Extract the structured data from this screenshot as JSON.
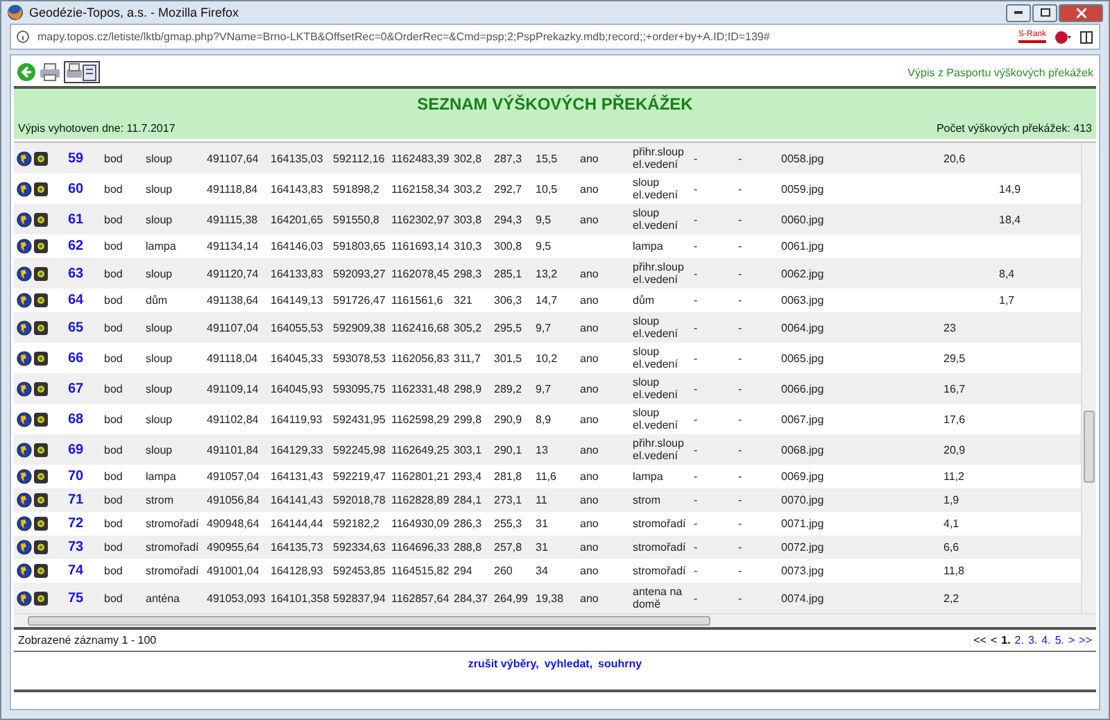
{
  "window": {
    "title": "Geodézie-Topos, a.s. - Mozilla Firefox"
  },
  "address_bar": {
    "url": "mapy.topos.cz/letiste/lktb/gmap.php?VName=Brno-LKTB&OffsetRec=0&OrderRec=&Cmd=psp;2;PspPrekazky.mdb;record;;+order+by+A.ID;ID=139#",
    "badge": "S-Rank"
  },
  "toolbar": {
    "link": "Výpis z Pasportu výškových překážek"
  },
  "header": {
    "title": "SEZNAM VÝŠKOVÝCH PŘEKÁŽEK",
    "date": "Výpis vyhotoven dne: 11.7.2017",
    "count": "Počet výškových překážek: 413"
  },
  "table": {
    "rows": [
      {
        "number": "59",
        "column_3": "bod",
        "column_4": "sloup",
        "column_5": "491107,64",
        "column_6": "164135,03",
        "column_7": "592112,16",
        "column_8": "1162483,39",
        "column_9": "302,8",
        "column_10": "287,3",
        "column_11": "15,5",
        "column_12": "ano",
        "column_13": "přihr.sloup el.vedení",
        "column_14": "-",
        "column_15": "-",
        "column_16": "0058.jpg",
        "column_17": "20,6"
      },
      {
        "number": "60",
        "column_3": "bod",
        "column_4": "sloup",
        "column_5": "491118,84",
        "column_6": "164143,83",
        "column_7": "591898,2",
        "column_8": "1162158,34",
        "column_9": "303,2",
        "column_10": "292,7",
        "column_11": "10,5",
        "column_12": "ano",
        "column_13": "sloup el.vedení",
        "column_14": "-",
        "column_15": "-",
        "column_16": "0059.jpg",
        "column_18": "14,9"
      },
      {
        "number": "61",
        "column_3": "bod",
        "column_4": "sloup",
        "column_5": "491115,38",
        "column_6": "164201,65",
        "column_7": "591550,8",
        "column_8": "1162302,97",
        "column_9": "303,8",
        "column_10": "294,3",
        "column_11": "9,5",
        "column_12": "ano",
        "column_13": "sloup el.vedení",
        "column_14": "-",
        "column_15": "-",
        "column_16": "0060.jpg",
        "column_18": "18,4"
      },
      {
        "number": "62",
        "column_3": "bod",
        "column_4": "lampa",
        "column_5": "491134,14",
        "column_6": "164146,03",
        "column_7": "591803,65",
        "column_8": "1161693,14",
        "column_9": "310,3",
        "column_10": "300,8",
        "column_11": "9,5",
        "column_13": "lampa",
        "column_14": "-",
        "column_15": "-",
        "column_16": "0061.jpg"
      },
      {
        "number": "63",
        "column_3": "bod",
        "column_4": "sloup",
        "column_5": "491120,74",
        "column_6": "164133,83",
        "column_7": "592093,27",
        "column_8": "1162078,45",
        "column_9": "298,3",
        "column_10": "285,1",
        "column_11": "13,2",
        "column_12": "ano",
        "column_13": "přihr.sloup el.vedení",
        "column_14": "-",
        "column_15": "-",
        "column_16": "0062.jpg",
        "column_18": "8,4"
      },
      {
        "number": "64",
        "column_3": "bod",
        "column_4": "dům",
        "column_5": "491138,64",
        "column_6": "164149,13",
        "column_7": "591726,47",
        "column_8": "1161561,6",
        "column_9": "321",
        "column_10": "306,3",
        "column_11": "14,7",
        "column_12": "ano",
        "column_13": "dům",
        "column_14": "-",
        "column_15": "-",
        "column_16": "0063.jpg",
        "column_18": "1,7"
      },
      {
        "number": "65",
        "column_3": "bod",
        "column_4": "sloup",
        "column_5": "491107,04",
        "column_6": "164055,53",
        "column_7": "592909,38",
        "column_8": "1162416,68",
        "column_9": "305,2",
        "column_10": "295,5",
        "column_11": "9,7",
        "column_12": "ano",
        "column_13": "sloup el.vedení",
        "column_14": "-",
        "column_15": "-",
        "column_16": "0064.jpg",
        "column_17": "23"
      },
      {
        "number": "66",
        "column_3": "bod",
        "column_4": "sloup",
        "column_5": "491118,04",
        "column_6": "164045,33",
        "column_7": "593078,53",
        "column_8": "1162056,83",
        "column_9": "311,7",
        "column_10": "301,5",
        "column_11": "10,2",
        "column_12": "ano",
        "column_13": "sloup el.vedení",
        "column_14": "-",
        "column_15": "-",
        "column_16": "0065.jpg",
        "column_17": "29,5"
      },
      {
        "number": "67",
        "column_3": "bod",
        "column_4": "sloup",
        "column_5": "491109,14",
        "column_6": "164045,93",
        "column_7": "593095,75",
        "column_8": "1162331,48",
        "column_9": "298,9",
        "column_10": "289,2",
        "column_11": "9,7",
        "column_12": "ano",
        "column_13": "sloup el.vedení",
        "column_14": "-",
        "column_15": "-",
        "column_16": "0066.jpg",
        "column_17": "16,7"
      },
      {
        "number": "68",
        "column_3": "bod",
        "column_4": "sloup",
        "column_5": "491102,84",
        "column_6": "164119,93",
        "column_7": "592431,95",
        "column_8": "1162598,29",
        "column_9": "299,8",
        "column_10": "290,9",
        "column_11": "8,9",
        "column_12": "ano",
        "column_13": "sloup el.vedení",
        "column_14": "-",
        "column_15": "-",
        "column_16": "0067.jpg",
        "column_17": "17,6"
      },
      {
        "number": "69",
        "column_3": "bod",
        "column_4": "sloup",
        "column_5": "491101,84",
        "column_6": "164129,33",
        "column_7": "592245,98",
        "column_8": "1162649,25",
        "column_9": "303,1",
        "column_10": "290,1",
        "column_11": "13",
        "column_12": "ano",
        "column_13": "přihr.sloup el.vedení",
        "column_14": "-",
        "column_15": "-",
        "column_16": "0068.jpg",
        "column_17": "20,9"
      },
      {
        "number": "70",
        "column_3": "bod",
        "column_4": "lampa",
        "column_5": "491057,04",
        "column_6": "164131,43",
        "column_7": "592219,47",
        "column_8": "1162801,21",
        "column_9": "293,4",
        "column_10": "281,8",
        "column_11": "11,6",
        "column_12": "ano",
        "column_13": "lampa",
        "column_14": "-",
        "column_15": "-",
        "column_16": "0069.jpg",
        "column_17": "11,2"
      },
      {
        "number": "71",
        "column_3": "bod",
        "column_4": "strom",
        "column_5": "491056,84",
        "column_6": "164141,43",
        "column_7": "592018,78",
        "column_8": "1162828,89",
        "column_9": "284,1",
        "column_10": "273,1",
        "column_11": "11",
        "column_12": "ano",
        "column_13": "strom",
        "column_14": "-",
        "column_15": "-",
        "column_16": "0070.jpg",
        "column_17": "1,9"
      },
      {
        "number": "72",
        "column_3": "bod",
        "column_4": "stromořadí",
        "column_5": "490948,64",
        "column_6": "164144,44",
        "column_7": "592182,2",
        "column_8": "1164930,09",
        "column_9": "286,3",
        "column_10": "255,3",
        "column_11": "31",
        "column_12": "ano",
        "column_13": "stromořadí",
        "column_14": "-",
        "column_15": "-",
        "column_16": "0071.jpg",
        "column_17": "4,1"
      },
      {
        "number": "73",
        "column_3": "bod",
        "column_4": "stromořadí",
        "column_5": "490955,64",
        "column_6": "164135,73",
        "column_7": "592334,63",
        "column_8": "1164696,33",
        "column_9": "288,8",
        "column_10": "257,8",
        "column_11": "31",
        "column_12": "ano",
        "column_13": "stromořadí",
        "column_14": "-",
        "column_15": "-",
        "column_16": "0072.jpg",
        "column_17": "6,6"
      },
      {
        "number": "74",
        "column_3": "bod",
        "column_4": "stromořadí",
        "column_5": "491001,04",
        "column_6": "164128,93",
        "column_7": "592453,85",
        "column_8": "1164515,82",
        "column_9": "294",
        "column_10": "260",
        "column_11": "34",
        "column_12": "ano",
        "column_13": "stromořadí",
        "column_14": "-",
        "column_15": "-",
        "column_16": "0073.jpg",
        "column_17": "11,8"
      },
      {
        "number": "75",
        "column_3": "bod",
        "column_4": "anténa",
        "column_5": "491053,093",
        "column_6": "164101,358",
        "column_7": "592837,94",
        "column_8": "1162857,64",
        "column_9": "284,37",
        "column_10": "264,99",
        "column_11": "19,38",
        "column_12": "ano",
        "column_13": "antena na domě",
        "column_14": "-",
        "column_15": "-",
        "column_16": "0074.jpg",
        "column_17": "2,2"
      }
    ]
  },
  "records": "Zobrazené záznamy 1 - 100",
  "pager": [
    {
      "label": "<<",
      "disabled": true,
      "selected": false
    },
    {
      "label": "<",
      "disabled": true,
      "selected": false
    },
    {
      "label": "1.",
      "disabled": false,
      "selected": true
    },
    {
      "label": "2.",
      "disabled": false,
      "selected": false
    },
    {
      "label": "3.",
      "disabled": false,
      "selected": false
    },
    {
      "label": "4.",
      "disabled": false,
      "selected": false
    },
    {
      "label": "5.",
      "disabled": false,
      "selected": false
    },
    {
      "label": ">",
      "disabled": false,
      "selected": false
    },
    {
      "label": ">>",
      "disabled": false,
      "selected": false
    }
  ],
  "footer_links": [
    "zrušit výběry,",
    "vyhledat,",
    "souhrny"
  ]
}
